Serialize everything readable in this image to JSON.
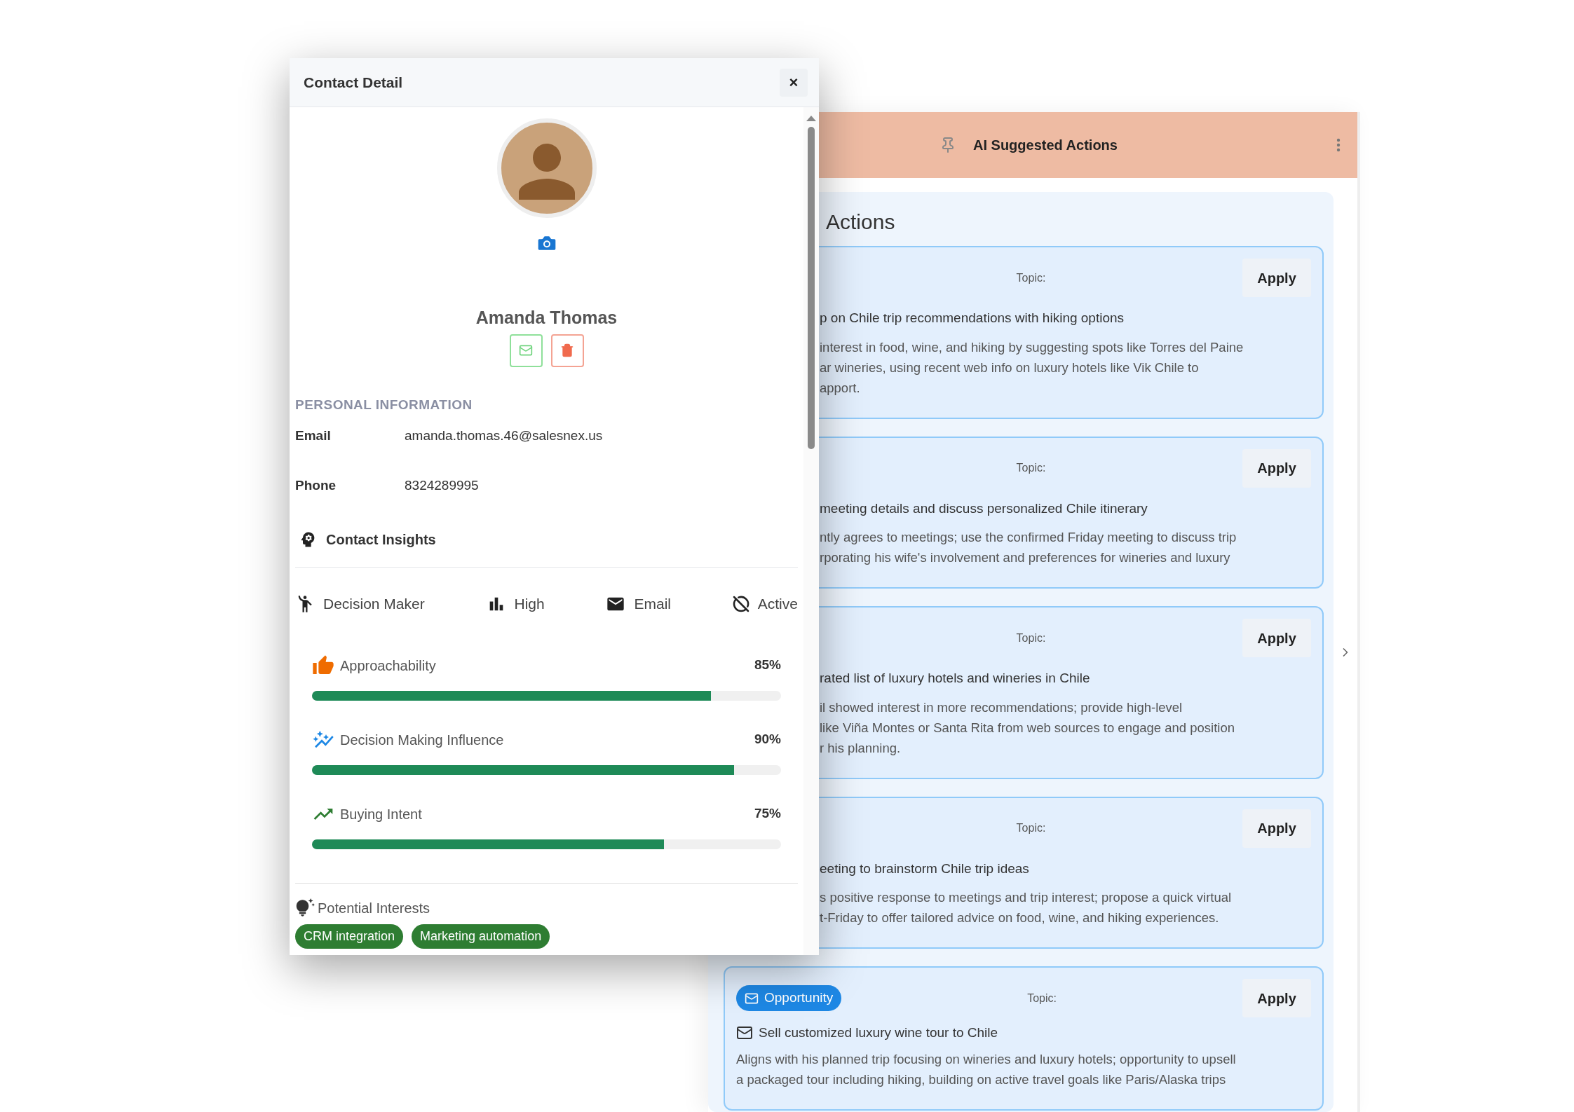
{
  "contact_detail": {
    "title": "Contact Detail",
    "close": "×",
    "name": "Amanda Thomas",
    "section_title": "PERSONAL INFORMATION",
    "fields": [
      {
        "label": "Email",
        "value": "amanda.thomas.46@salesnex.us"
      },
      {
        "label": "Phone",
        "value": "8324289995"
      }
    ],
    "insights_title": "Contact Insights",
    "tags": [
      {
        "kind": "role",
        "label": "Decision Maker"
      },
      {
        "kind": "priority",
        "label": "High"
      },
      {
        "kind": "channel",
        "label": "Email"
      },
      {
        "kind": "status",
        "label": "Active"
      }
    ],
    "metrics": [
      {
        "kind": "approachability",
        "label": "Approachability",
        "reading": "85%",
        "level": 0.85
      },
      {
        "kind": "influence",
        "label": "Decision Making Influence",
        "reading": "90%",
        "level": 0.9
      },
      {
        "kind": "intent",
        "label": "Buying Intent",
        "reading": "75%",
        "level": 0.75
      }
    ],
    "interests_title": "Potential Interests",
    "interests": [
      "CRM integration",
      "Marketing automation"
    ]
  },
  "suggested_actions": {
    "title": "AI Suggested Actions",
    "heading": "Actions",
    "cards": [
      {
        "topic_label": "Topic:",
        "apply": "Apply",
        "title": "p on Chile trip recommendations with hiking options",
        "description_lines": [
          "interest in food, wine, and hiking by suggesting spots like Torres del Paine",
          "ar wineries, using recent web info on luxury hotels like Vik Chile to",
          "apport."
        ]
      },
      {
        "topic_label": "Topic:",
        "apply": "Apply",
        "title": "meeting details and discuss personalized Chile itinerary",
        "description_lines": [
          "ntly agrees to meetings; use the confirmed Friday meeting to discuss trip",
          "rporating his wife's involvement and preferences for wineries and luxury"
        ]
      },
      {
        "topic_label": "Topic:",
        "apply": "Apply",
        "title": "rated list of luxury hotels and wineries in Chile",
        "description_lines": [
          "il showed interest in more recommendations; provide high-level",
          "like Viña Montes or Santa Rita from web sources to engage and position",
          "r his planning."
        ]
      },
      {
        "topic_label": "Topic:",
        "apply": "Apply",
        "title": "eeting to brainstorm Chile trip ideas",
        "description_lines": [
          "s positive response to meetings and trip interest; propose a quick virtual",
          "t-Friday to offer tailored advice on food, wine, and hiking experiences."
        ]
      },
      {
        "badge": "Opportunity",
        "topic_label": "Topic:",
        "apply": "Apply",
        "title": "Sell customized luxury wine tour to Chile",
        "description_lines": [
          "Aligns with his planned trip focusing on wineries and luxury hotels; opportunity to upsell",
          "a packaged tour including hiking, building on active travel goals like Paris/Alaska trips"
        ]
      }
    ]
  }
}
